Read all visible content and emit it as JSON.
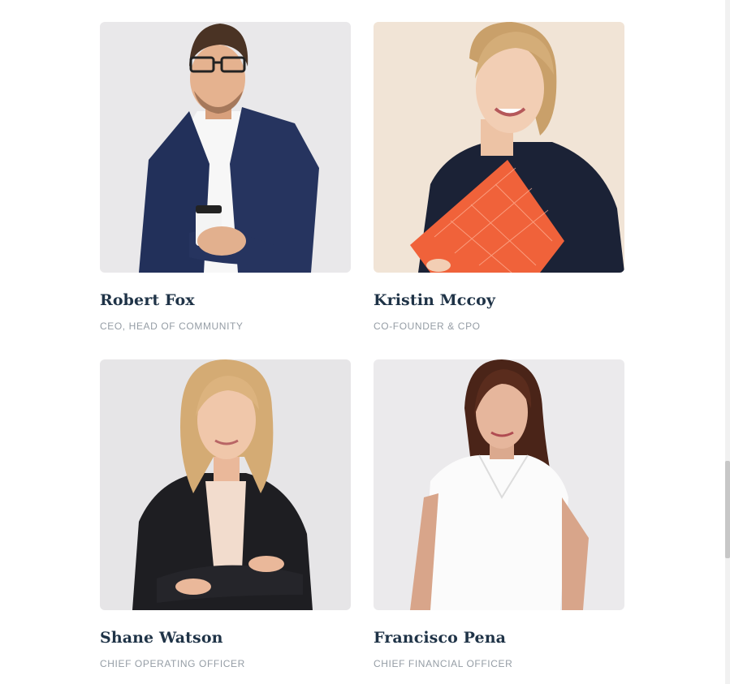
{
  "team": {
    "members": [
      {
        "name": "Robert Fox",
        "role": "CEO, Head of Community",
        "photo": "man-with-glasses-holding-coffee"
      },
      {
        "name": "Kristin Mccoy",
        "role": "Co-Founder & CPO",
        "photo": "woman-holding-orange-folder"
      },
      {
        "name": "Shane Watson",
        "role": "Chief Operating Officer",
        "photo": "woman-in-black-blazer-arms-crossed"
      },
      {
        "name": "Francisco Pena",
        "role": "Chief Financial Officer",
        "photo": "woman-in-white-blouse"
      }
    ]
  },
  "colors": {
    "name_text": "#1f3347",
    "role_text": "#959da5",
    "photo_bg_gray": "#e9e8ea",
    "photo_bg_beige": "#f1e4d6"
  }
}
